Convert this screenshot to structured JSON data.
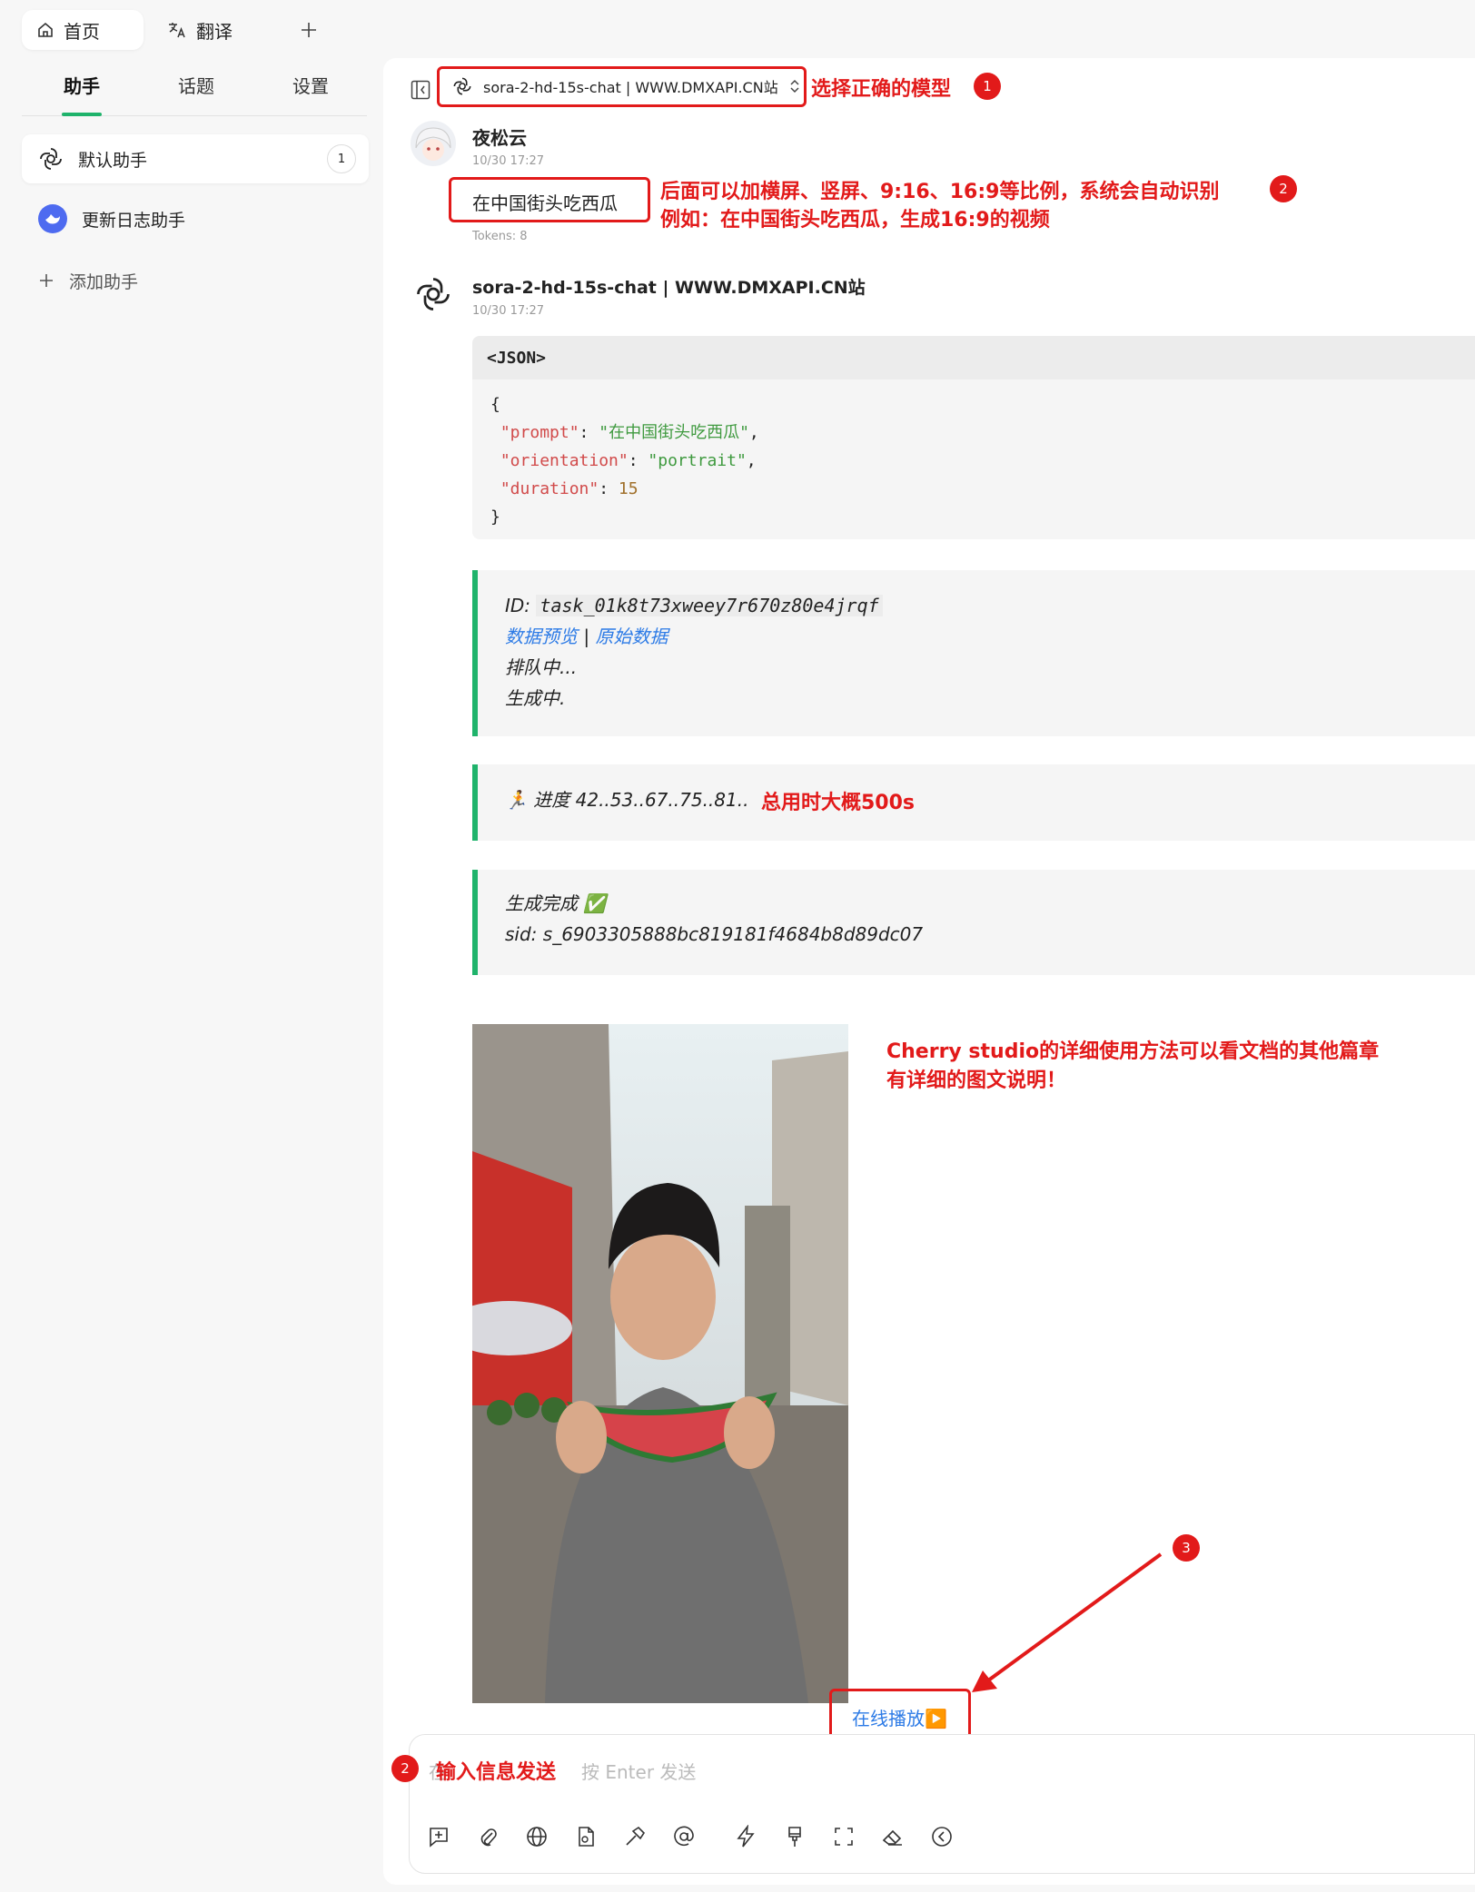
{
  "top_tabs": [
    {
      "label": "首页"
    },
    {
      "label": "翻译"
    }
  ],
  "sidebar": {
    "subtabs": [
      {
        "label": "助手"
      },
      {
        "label": "话题"
      },
      {
        "label": "设置"
      }
    ],
    "assistants": [
      {
        "label": "默认助手",
        "badge": "1"
      },
      {
        "label": "更新日志助手"
      }
    ],
    "add_label": "添加助手"
  },
  "header": {
    "model": "sora-2-hd-15s-chat | WWW.DMXAPI.CN站"
  },
  "user_msg": {
    "name": "夜松云",
    "time": "10/30 17:27",
    "text": "在中国街头吃西瓜",
    "tokens": "Tokens: 8"
  },
  "bot_msg": {
    "name": "sora-2-hd-15s-chat | WWW.DMXAPI.CN站",
    "time": "10/30 17:27",
    "code_lang": "<JSON>",
    "code": {
      "prompt_key": "\"prompt\"",
      "prompt_val": "\"在中国街头吃西瓜\"",
      "orientation_key": "\"orientation\"",
      "orientation_val": "\"portrait\"",
      "duration_key": "\"duration\"",
      "duration_val": "15"
    },
    "q1": {
      "id_label": "ID:",
      "id_val": "task_01k8t73xweey7r670z80e4jrqf",
      "link1": "数据预览",
      "sep": "|",
      "link2": "原始数据",
      "line3": "排队中...",
      "line4": "生成中."
    },
    "q2": {
      "emoji": "🏃",
      "text": "进度 42..53..67..75..81.."
    },
    "q3": {
      "line1": "生成完成",
      "check": "✅",
      "line2": "sid: s_6903305888bc819181f4684b8d89dc07"
    },
    "play_label": "在线播放▶️"
  },
  "annotations": {
    "a1": "选择正确的模型",
    "n1": "1",
    "a2_l1": "后面可以加横屏、竖屏、9:16、16:9等比例，系统会自动识别",
    "a2_l2": "例如：在中国街头吃西瓜，生成16:9的视频",
    "n2": "2",
    "a3": "总用时大概500s",
    "a4_l1": "Cherry studio的详细使用方法可以看文档的其他篇章",
    "a4_l2": "有详细的图文说明！",
    "n3": "3",
    "a5": "输入信息发送",
    "n5": "2"
  },
  "input": {
    "placeholder_start": "在",
    "placeholder_end": "按 Enter 发送"
  },
  "colors": {
    "accent": "#1fb36b",
    "annotation": "#e21a1a",
    "link": "#2d7be6"
  }
}
